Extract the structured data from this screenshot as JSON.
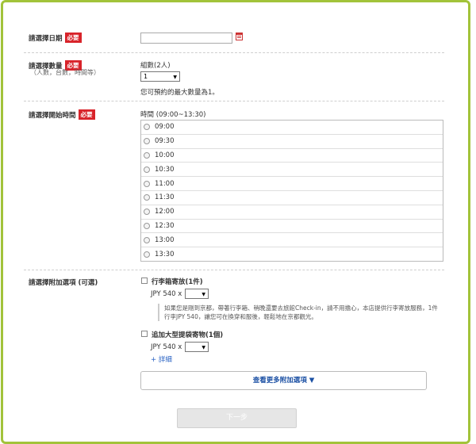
{
  "form": {
    "date": {
      "label": "請選擇日期",
      "required": "必要",
      "value": ""
    },
    "quantity": {
      "label": "請選擇數量",
      "required": "必要",
      "sublabel": "（人數，台數，時間等）",
      "unit_label": "組數(2人)",
      "selected": "1",
      "max_note": "您可預約的最大數量為1。"
    },
    "start_time": {
      "label": "請選擇開始時間",
      "required": "必要",
      "range_label": "時間 (09:00~13:30)",
      "options": [
        "09:00",
        "09:30",
        "10:00",
        "10:30",
        "11:00",
        "11:30",
        "12:00",
        "12:30",
        "13:00",
        "13:30"
      ]
    },
    "addons": {
      "label": "請選擇附加選項 (可選)",
      "items": [
        {
          "title": "行李箱寄放(1件)",
          "price": "JPY 540 x",
          "description": "如果您是剛到京都，帶著行李箱、稍晚還要去旅館Check-in，請不用擔心，本店提供行李寄放服務，1件行李JPY 540，讓您可在換穿和服後，輕鬆地在京都觀光。"
        },
        {
          "title": "追加大型提袋寄物(1個)",
          "price": "JPY 540 x",
          "detail_link": "+ 詳細"
        }
      ],
      "more_button": "查看更多附加選項 ▼"
    },
    "next_button": "下一步"
  },
  "colors": {
    "required_badge": "#d8232a",
    "frame": "#a2c33a",
    "link": "#2a63c4"
  }
}
